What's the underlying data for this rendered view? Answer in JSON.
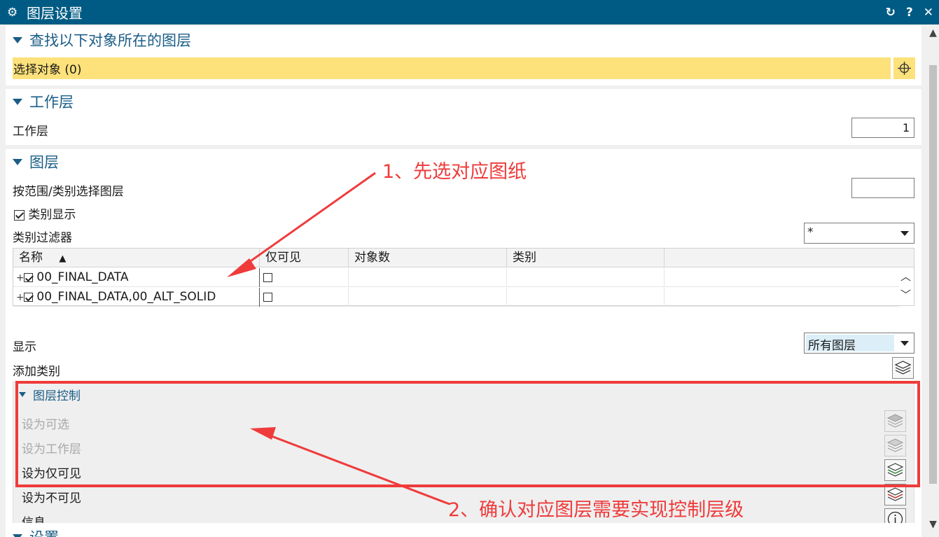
{
  "window": {
    "title": "图层设置",
    "gear_icon": "gear-icon",
    "buttons": {
      "reset": "↻",
      "help": "?",
      "close": "✕"
    }
  },
  "find_section": {
    "title": "查找以下对象所在的图层",
    "select_label": "选择对象 (0)",
    "crosshair_icon": "crosshair-icon"
  },
  "work_layer_section": {
    "title": "工作层",
    "field_label": "工作层",
    "field_value": "1"
  },
  "layers_section": {
    "title": "图层",
    "range_label": "按范围/类别选择图层",
    "range_value": "",
    "category_display_label": "类别显示",
    "category_display_checked": true,
    "filter_label": "类别过滤器",
    "filter_value": "*",
    "table": {
      "columns": [
        "名称",
        "仅可见",
        "对象数",
        "类别"
      ],
      "rows": [
        {
          "name": "00_FINAL_DATA",
          "checked": true,
          "visible_only": false,
          "count": "",
          "category": ""
        },
        {
          "name": "00_FINAL_DATA,00_ALT_SOLID",
          "checked": true,
          "visible_only": false,
          "count": "",
          "category": ""
        }
      ]
    },
    "display_label": "显示",
    "display_value": "所有图层",
    "add_category_label": "添加类别"
  },
  "layer_control": {
    "title": "图层控制",
    "items": [
      {
        "label": "设为可选",
        "enabled": false
      },
      {
        "label": "设为工作层",
        "enabled": false
      },
      {
        "label": "设为仅可见",
        "enabled": true
      },
      {
        "label": "设为不可见",
        "enabled": true
      },
      {
        "label": "信息",
        "enabled": true
      }
    ]
  },
  "settings_section": {
    "title": "设置"
  },
  "annotations": {
    "note1": "1、先选对应图纸",
    "note2": "2、确认对应图层需要实现控制层级",
    "color": "#ef3b3b"
  },
  "colors": {
    "titlebar": "#005b84",
    "section_header": "#1a5d86",
    "selection_highlight": "#fde17a"
  }
}
